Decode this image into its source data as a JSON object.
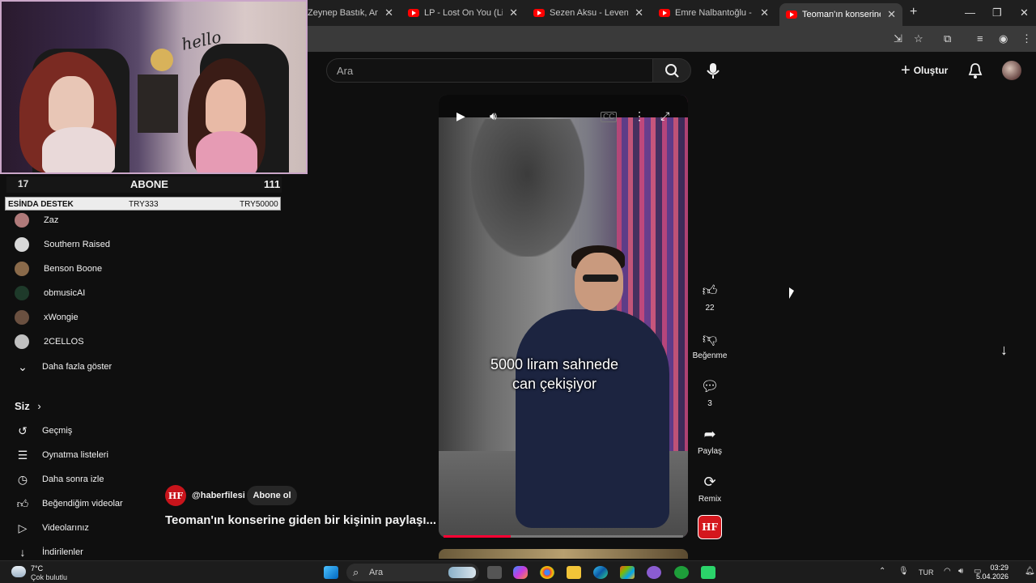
{
  "browser": {
    "tabs": [
      {
        "title": "Zeynep Bastık, Anıl Piyancı",
        "active": false
      },
      {
        "title": "LP - Lost On You (Live) - YouTube",
        "active": false
      },
      {
        "title": "Sezen Aksu - Levent Yüksel",
        "active": false
      },
      {
        "title": "Emre Nalbantoğlu - Hane",
        "active": false
      },
      {
        "title": "Teoman'ın konserine giden",
        "active": true
      }
    ],
    "new_tab_symbol": "+"
  },
  "header": {
    "search_placeholder": "Ara",
    "create_label": "Oluştur"
  },
  "stream": {
    "overlay_text": "hello",
    "sub_count_left": "17",
    "sub_label": "ABONE",
    "sub_count_right": "111",
    "donation_title": "ESİNDA DESTEK",
    "donation_amount_1": "TRY333",
    "donation_amount_2": "TRY50000"
  },
  "sidebar": {
    "subscriptions": [
      {
        "label": "Zaz",
        "color": "#b07a7a"
      },
      {
        "label": "Southern Raised",
        "color": "#d8d8d8"
      },
      {
        "label": "Benson Boone",
        "color": "#8a6a4a"
      },
      {
        "label": "obmusicAI",
        "color": "#1e3a2a"
      },
      {
        "label": "xWongie",
        "color": "#6a5040"
      },
      {
        "label": "2CELLOS",
        "color": "#c0c0c0"
      }
    ],
    "show_more": "Daha fazla göster",
    "you_section": "Siz",
    "you_items": [
      {
        "label": "Geçmiş",
        "icon": "history-icon"
      },
      {
        "label": "Oynatma listeleri",
        "icon": "playlist-icon"
      },
      {
        "label": "Daha sonra izle",
        "icon": "clock-icon"
      },
      {
        "label": "Beğendiğim videolar",
        "icon": "like-icon"
      },
      {
        "label": "Videolarınız",
        "icon": "video-icon"
      },
      {
        "label": "İndirilenler",
        "icon": "download-icon"
      }
    ]
  },
  "video": {
    "caption_line1": "5000 liram sahnede",
    "caption_line2": "can çekişiyor",
    "progress": 0.28,
    "title": "Teoman'ın konserine giden bir kişinin paylaşı...",
    "channel_handle": "@haberfilesi",
    "subscribe_label": "Abone ol",
    "channel_logo_text": "HF"
  },
  "actions": {
    "like_count": "22",
    "dislike_label": "Beğenme",
    "comment_count": "3",
    "share_label": "Paylaş",
    "remix_label": "Remix"
  },
  "taskbar": {
    "weather_temp": "7°C",
    "weather_desc": "Çok bulutlu",
    "search_placeholder": "Ara",
    "language": "TUR",
    "time": "03:29",
    "date": "5.04.2026"
  },
  "colors": {
    "accent": "#ff0033",
    "background": "#0f0f0f",
    "channel_brand": "#d4171d"
  }
}
